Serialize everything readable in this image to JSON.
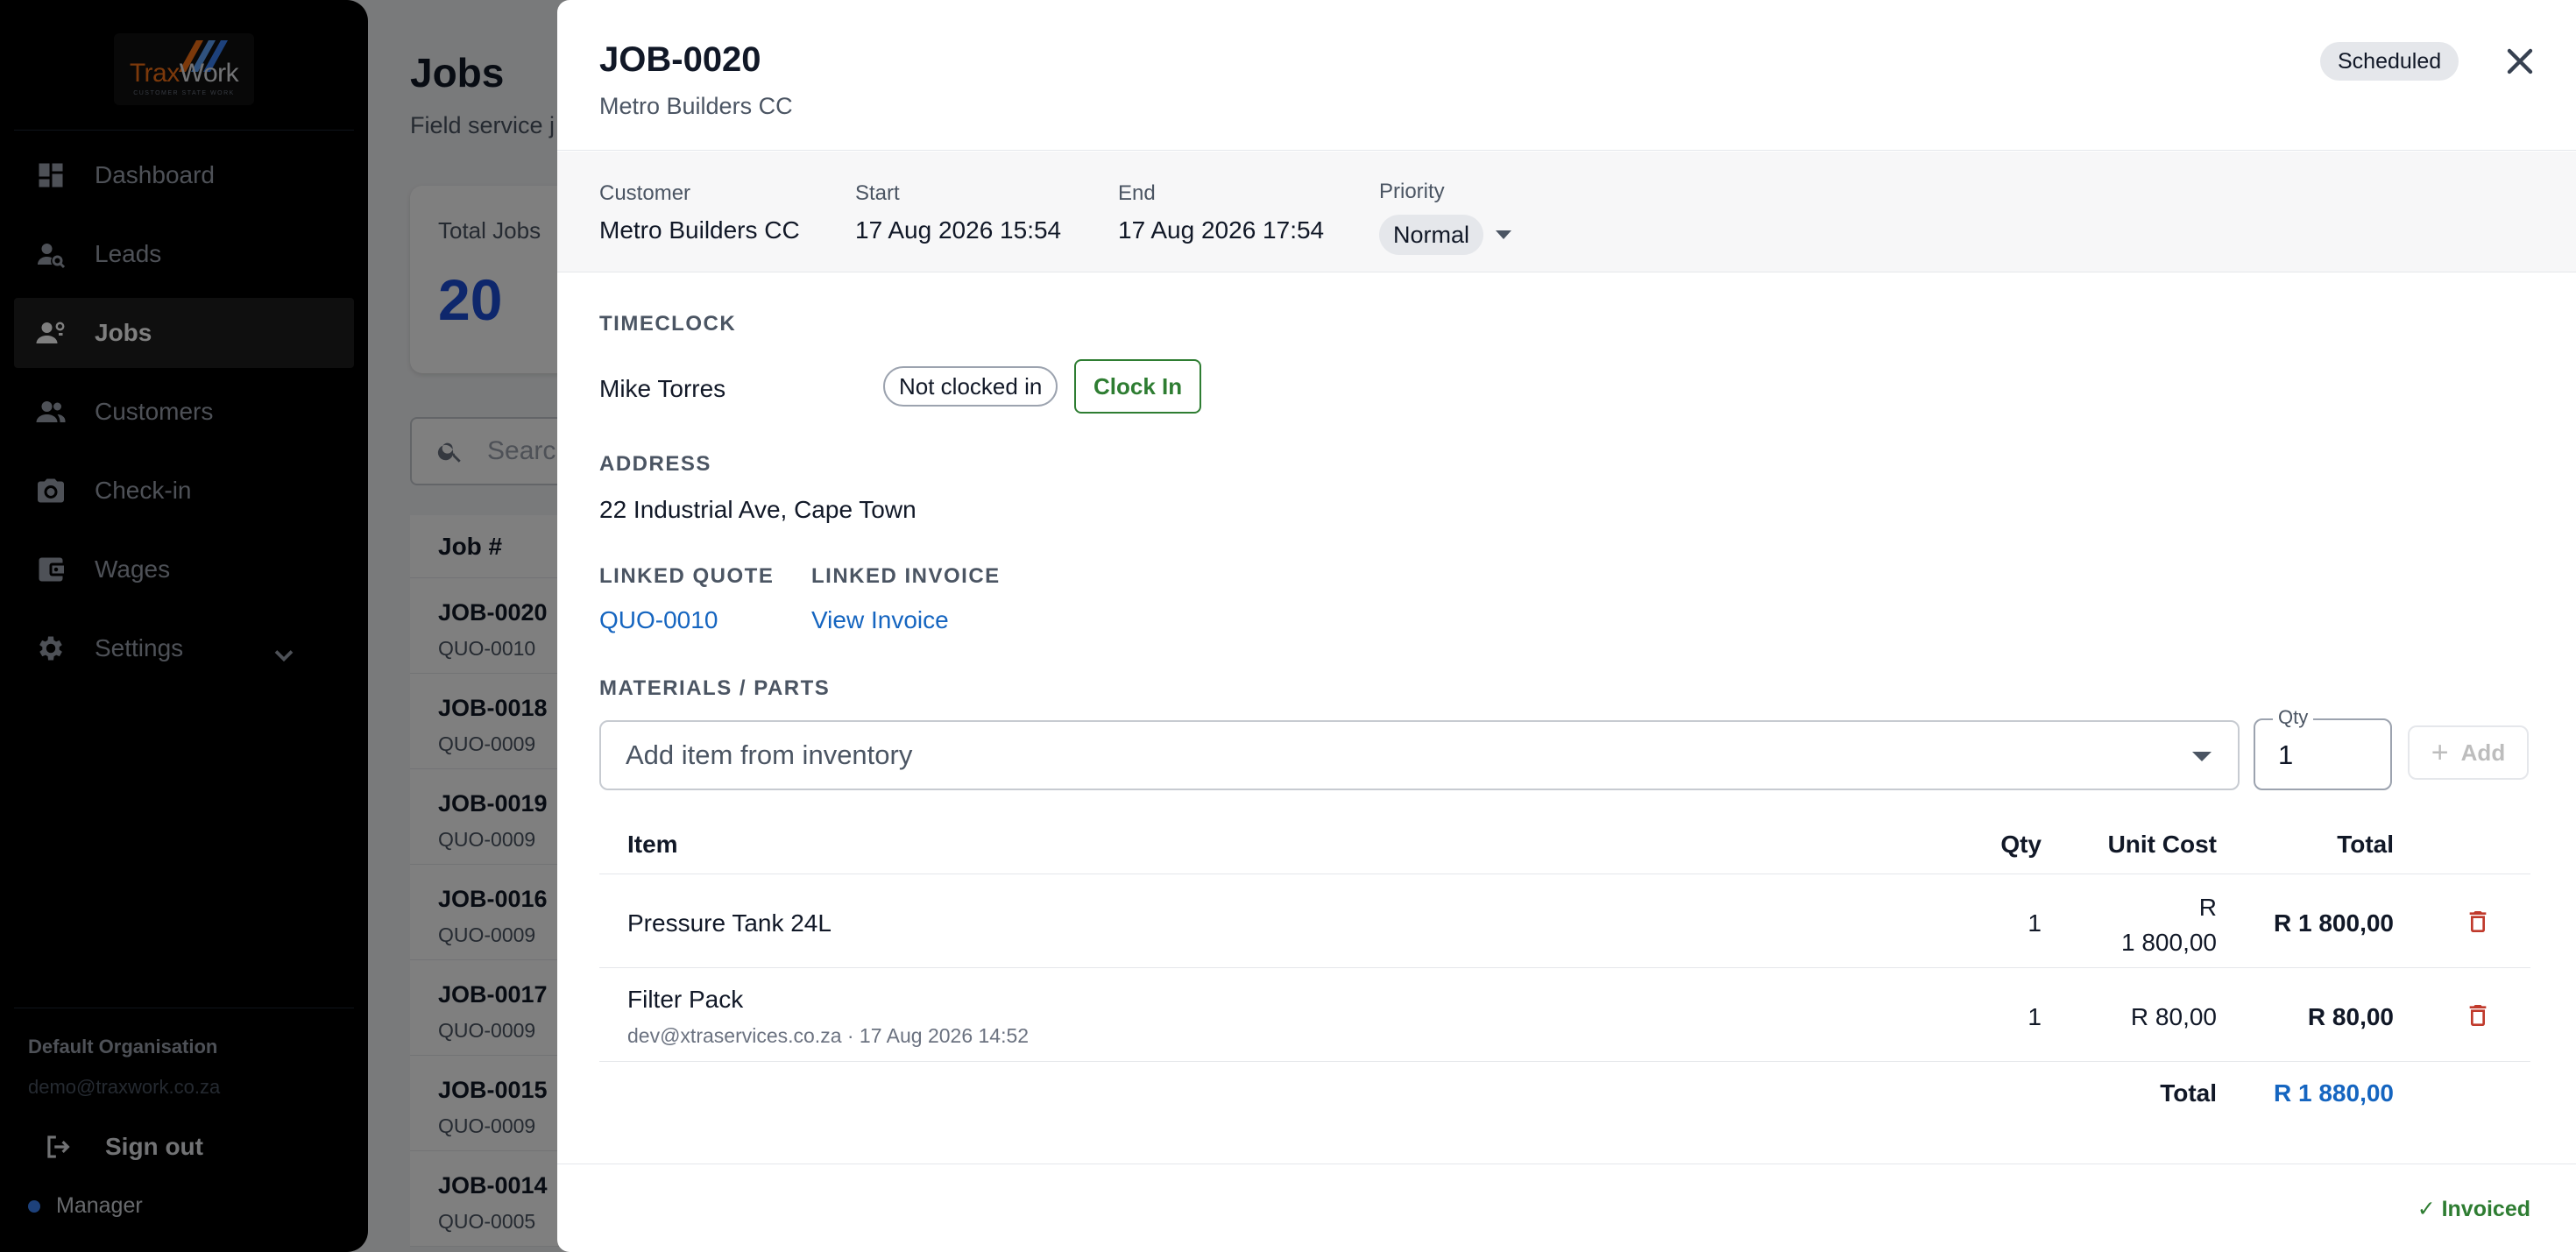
{
  "sidebar": {
    "logo": {
      "part1": "Trax",
      "part2": "Work",
      "tagline": "CUSTOMER STATE WORK"
    },
    "nav": [
      {
        "label": "Dashboard",
        "icon": "dashboard-icon"
      },
      {
        "label": "Leads",
        "icon": "leads-icon"
      },
      {
        "label": "Jobs",
        "icon": "jobs-icon",
        "active": true
      },
      {
        "label": "Customers",
        "icon": "customers-icon"
      },
      {
        "label": "Check-in",
        "icon": "camera-icon"
      },
      {
        "label": "Wages",
        "icon": "wallet-icon"
      },
      {
        "label": "Settings",
        "icon": "gear-icon"
      }
    ],
    "org_name": "Default Organisation",
    "org_email": "demo@traxwork.co.za",
    "signout_label": "Sign out",
    "role": "Manager"
  },
  "page": {
    "title": "Jobs",
    "subtitle": "Field service j",
    "stat_label": "Total Jobs",
    "stat_value": "20",
    "search_placeholder": "Searc",
    "table_header": "Job #",
    "rows": [
      {
        "job": "JOB-0020",
        "quote": "QUO-0010"
      },
      {
        "job": "JOB-0018",
        "quote": "QUO-0009"
      },
      {
        "job": "JOB-0019",
        "quote": "QUO-0009"
      },
      {
        "job": "JOB-0016",
        "quote": "QUO-0009"
      },
      {
        "job": "JOB-0017",
        "quote": "QUO-0009"
      },
      {
        "job": "JOB-0015",
        "quote": "QUO-0009"
      },
      {
        "job": "JOB-0014",
        "quote": "QUO-0005"
      }
    ]
  },
  "modal": {
    "title": "JOB-0020",
    "subtitle": "Metro Builders CC",
    "status": "Scheduled",
    "info": {
      "customer_label": "Customer",
      "customer": "Metro Builders CC",
      "start_label": "Start",
      "start": "17 Aug 2026 15:54",
      "end_label": "End",
      "end": "17 Aug 2026 17:54",
      "priority_label": "Priority",
      "priority": "Normal"
    },
    "timeclock": {
      "label": "TIMECLOCK",
      "technician": "Mike Torres",
      "state": "Not clocked in",
      "button": "Clock In"
    },
    "address": {
      "label": "ADDRESS",
      "value": "22 Industrial Ave, Cape Town"
    },
    "linked_quote": {
      "label": "LINKED QUOTE",
      "value": "QUO-0010"
    },
    "linked_invoice": {
      "label": "LINKED INVOICE",
      "value": "View Invoice"
    },
    "materials": {
      "label": "MATERIALS / PARTS",
      "placeholder": "Add item from inventory",
      "qty_label": "Qty",
      "qty_value": "1",
      "add_label": "Add",
      "columns": {
        "item": "Item",
        "qty": "Qty",
        "unit_cost": "Unit Cost",
        "total": "Total"
      },
      "items": [
        {
          "item": "Pressure Tank 24L",
          "sub": "",
          "qty": "1",
          "unit_cost_a": "R",
          "unit_cost_b": "1 800,00",
          "total": "R 1 800,00"
        },
        {
          "item": "Filter Pack",
          "sub": "dev@xtraservices.co.za · 17 Aug 2026 14:52",
          "qty": "1",
          "unit_cost_a": "R 80,00",
          "unit_cost_b": "",
          "total": "R 80,00"
        }
      ],
      "total_label": "Total",
      "total_value": "R 1 880,00"
    },
    "footer_status": "✓ Invoiced"
  },
  "colors": {
    "accent_blue": "#1565c0",
    "success_green": "#2e7d32",
    "danger_red": "#c0392b",
    "stat_blue": "#1d4ed8"
  }
}
